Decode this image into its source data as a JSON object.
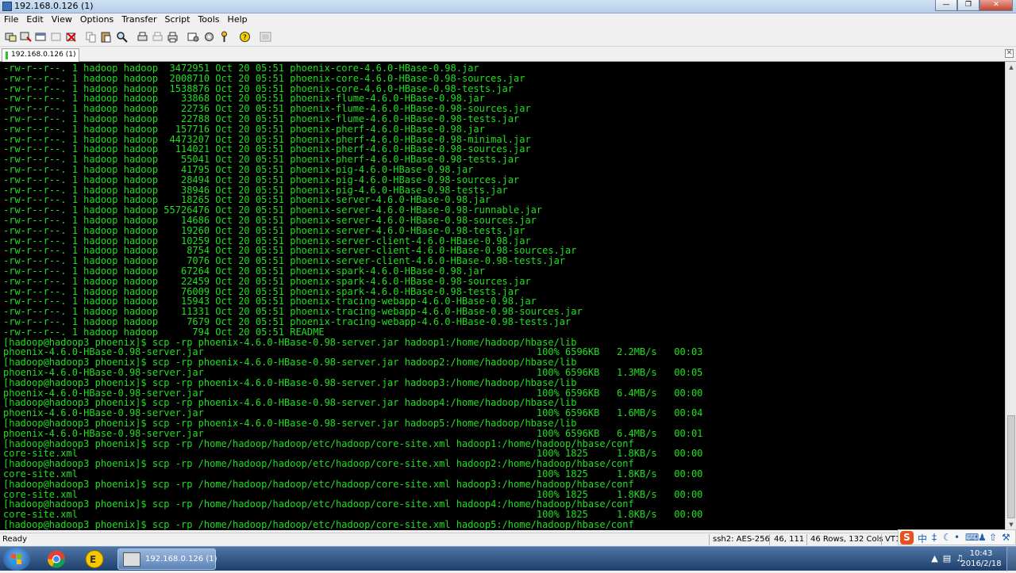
{
  "window": {
    "title": "192.168.0.126 (1)"
  },
  "menu": [
    "File",
    "Edit",
    "View",
    "Options",
    "Transfer",
    "Script",
    "Tools",
    "Help"
  ],
  "tab": {
    "label": "192.168.0.126 (1)"
  },
  "terminal_lines": [
    "-rw-r--r--. 1 hadoop hadoop  3472951 Oct 20 05:51 phoenix-core-4.6.0-HBase-0.98.jar",
    "-rw-r--r--. 1 hadoop hadoop  2008710 Oct 20 05:51 phoenix-core-4.6.0-HBase-0.98-sources.jar",
    "-rw-r--r--. 1 hadoop hadoop  1538876 Oct 20 05:51 phoenix-core-4.6.0-HBase-0.98-tests.jar",
    "-rw-r--r--. 1 hadoop hadoop    33868 Oct 20 05:51 phoenix-flume-4.6.0-HBase-0.98.jar",
    "-rw-r--r--. 1 hadoop hadoop    22736 Oct 20 05:51 phoenix-flume-4.6.0-HBase-0.98-sources.jar",
    "-rw-r--r--. 1 hadoop hadoop    22788 Oct 20 05:51 phoenix-flume-4.6.0-HBase-0.98-tests.jar",
    "-rw-r--r--. 1 hadoop hadoop   157716 Oct 20 05:51 phoenix-pherf-4.6.0-HBase-0.98.jar",
    "-rw-r--r--. 1 hadoop hadoop  4473207 Oct 20 05:51 phoenix-pherf-4.6.0-HBase-0.98-minimal.jar",
    "-rw-r--r--. 1 hadoop hadoop   114021 Oct 20 05:51 phoenix-pherf-4.6.0-HBase-0.98-sources.jar",
    "-rw-r--r--. 1 hadoop hadoop    55041 Oct 20 05:51 phoenix-pherf-4.6.0-HBase-0.98-tests.jar",
    "-rw-r--r--. 1 hadoop hadoop    41795 Oct 20 05:51 phoenix-pig-4.6.0-HBase-0.98.jar",
    "-rw-r--r--. 1 hadoop hadoop    28494 Oct 20 05:51 phoenix-pig-4.6.0-HBase-0.98-sources.jar",
    "-rw-r--r--. 1 hadoop hadoop    38946 Oct 20 05:51 phoenix-pig-4.6.0-HBase-0.98-tests.jar",
    "-rw-r--r--. 1 hadoop hadoop    18265 Oct 20 05:51 phoenix-server-4.6.0-HBase-0.98.jar",
    "-rw-r--r--. 1 hadoop hadoop 55726476 Oct 20 05:51 phoenix-server-4.6.0-HBase-0.98-runnable.jar",
    "-rw-r--r--. 1 hadoop hadoop    14686 Oct 20 05:51 phoenix-server-4.6.0-HBase-0.98-sources.jar",
    "-rw-r--r--. 1 hadoop hadoop    19260 Oct 20 05:51 phoenix-server-4.6.0-HBase-0.98-tests.jar",
    "-rw-r--r--. 1 hadoop hadoop    10259 Oct 20 05:51 phoenix-server-client-4.6.0-HBase-0.98.jar",
    "-rw-r--r--. 1 hadoop hadoop     8754 Oct 20 05:51 phoenix-server-client-4.6.0-HBase-0.98-sources.jar",
    "-rw-r--r--. 1 hadoop hadoop     7076 Oct 20 05:51 phoenix-server-client-4.6.0-HBase-0.98-tests.jar",
    "-rw-r--r--. 1 hadoop hadoop    67264 Oct 20 05:51 phoenix-spark-4.6.0-HBase-0.98.jar",
    "-rw-r--r--. 1 hadoop hadoop    22459 Oct 20 05:51 phoenix-spark-4.6.0-HBase-0.98-sources.jar",
    "-rw-r--r--. 1 hadoop hadoop    76009 Oct 20 05:51 phoenix-spark-4.6.0-HBase-0.98-tests.jar",
    "-rw-r--r--. 1 hadoop hadoop    15943 Oct 20 05:51 phoenix-tracing-webapp-4.6.0-HBase-0.98.jar",
    "-rw-r--r--. 1 hadoop hadoop    11331 Oct 20 05:51 phoenix-tracing-webapp-4.6.0-HBase-0.98-sources.jar",
    "-rw-r--r--. 1 hadoop hadoop     7679 Oct 20 05:51 phoenix-tracing-webapp-4.6.0-HBase-0.98-tests.jar",
    "-rw-r--r--. 1 hadoop hadoop      794 Oct 20 05:51 README",
    "[hadoop@hadoop3 phoenix]$ scp -rp phoenix-4.6.0-HBase-0.98-server.jar hadoop1:/home/hadoop/hbase/lib",
    "phoenix-4.6.0-HBase-0.98-server.jar                                                          100% 6596KB   2.2MB/s   00:03",
    "[hadoop@hadoop3 phoenix]$ scp -rp phoenix-4.6.0-HBase-0.98-server.jar hadoop2:/home/hadoop/hbase/lib",
    "phoenix-4.6.0-HBase-0.98-server.jar                                                          100% 6596KB   1.3MB/s   00:05",
    "[hadoop@hadoop3 phoenix]$ scp -rp phoenix-4.6.0-HBase-0.98-server.jar hadoop3:/home/hadoop/hbase/lib",
    "phoenix-4.6.0-HBase-0.98-server.jar                                                          100% 6596KB   6.4MB/s   00:00",
    "[hadoop@hadoop3 phoenix]$ scp -rp phoenix-4.6.0-HBase-0.98-server.jar hadoop4:/home/hadoop/hbase/lib",
    "phoenix-4.6.0-HBase-0.98-server.jar                                                          100% 6596KB   1.6MB/s   00:04",
    "[hadoop@hadoop3 phoenix]$ scp -rp phoenix-4.6.0-HBase-0.98-server.jar hadoop5:/home/hadoop/hbase/lib",
    "phoenix-4.6.0-HBase-0.98-server.jar                                                          100% 6596KB   6.4MB/s   00:01",
    "[hadoop@hadoop3 phoenix]$ scp -rp /home/hadoop/hadoop/etc/hadoop/core-site.xml hadoop1:/home/hadoop/hbase/conf",
    "core-site.xml                                                                                100% 1825     1.8KB/s   00:00",
    "[hadoop@hadoop3 phoenix]$ scp -rp /home/hadoop/hadoop/etc/hadoop/core-site.xml hadoop2:/home/hadoop/hbase/conf",
    "core-site.xml                                                                                100% 1825     1.8KB/s   00:00",
    "[hadoop@hadoop3 phoenix]$ scp -rp /home/hadoop/hadoop/etc/hadoop/core-site.xml hadoop3:/home/hadoop/hbase/conf",
    "core-site.xml                                                                                100% 1825     1.8KB/s   00:00",
    "[hadoop@hadoop3 phoenix]$ scp -rp /home/hadoop/hadoop/etc/hadoop/core-site.xml hadoop4:/home/hadoop/hbase/conf",
    "core-site.xml                                                                                100% 1825     1.8KB/s   00:00",
    "[hadoop@hadoop3 phoenix]$ scp -rp /home/hadoop/hadoop/etc/hadoop/core-site.xml hadoop5:/home/hadoop/hbase/conf"
  ],
  "status": {
    "ready": "Ready",
    "cipher": "ssh2: AES-256",
    "cursor": "46, 111",
    "size": "46 Rows, 132 Cols",
    "term": "VT1"
  },
  "ime": {
    "lang": "中"
  },
  "taskbar": {
    "window_label": "192.168.0.126 (1)"
  },
  "clock": {
    "time": "10:43",
    "date": "2016/2/18"
  },
  "colors": {
    "terminal_fg": "#1fe01f",
    "terminal_bg": "#000000"
  }
}
